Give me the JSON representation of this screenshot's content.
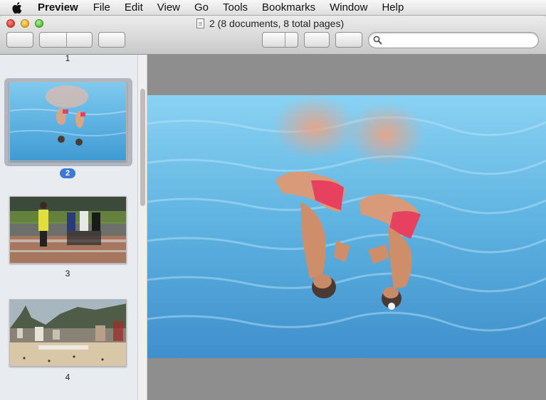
{
  "menubar": {
    "apple_icon": "apple-logo-icon",
    "app_name": "Preview",
    "items": [
      "File",
      "Edit",
      "View",
      "Go",
      "Tools",
      "Bookmarks",
      "Window",
      "Help"
    ]
  },
  "window": {
    "title": "2 (8 documents, 8 total pages)",
    "title_icon": "document-icon"
  },
  "search": {
    "placeholder": "",
    "value": "",
    "icon": "search-icon"
  },
  "sidebar": {
    "thumbnails": [
      {
        "label": "1",
        "content": ""
      },
      {
        "label": "2",
        "content": "synchronized-swimmers-underwater",
        "selected": true
      },
      {
        "label": "3",
        "content": "sprinters-racing"
      },
      {
        "label": "4",
        "content": "beach-with-mountains"
      }
    ]
  },
  "colors": {
    "selection_blue": "#3d78d6",
    "water": "#5fb3e0",
    "canvas_gray": "#8e8e8e"
  }
}
